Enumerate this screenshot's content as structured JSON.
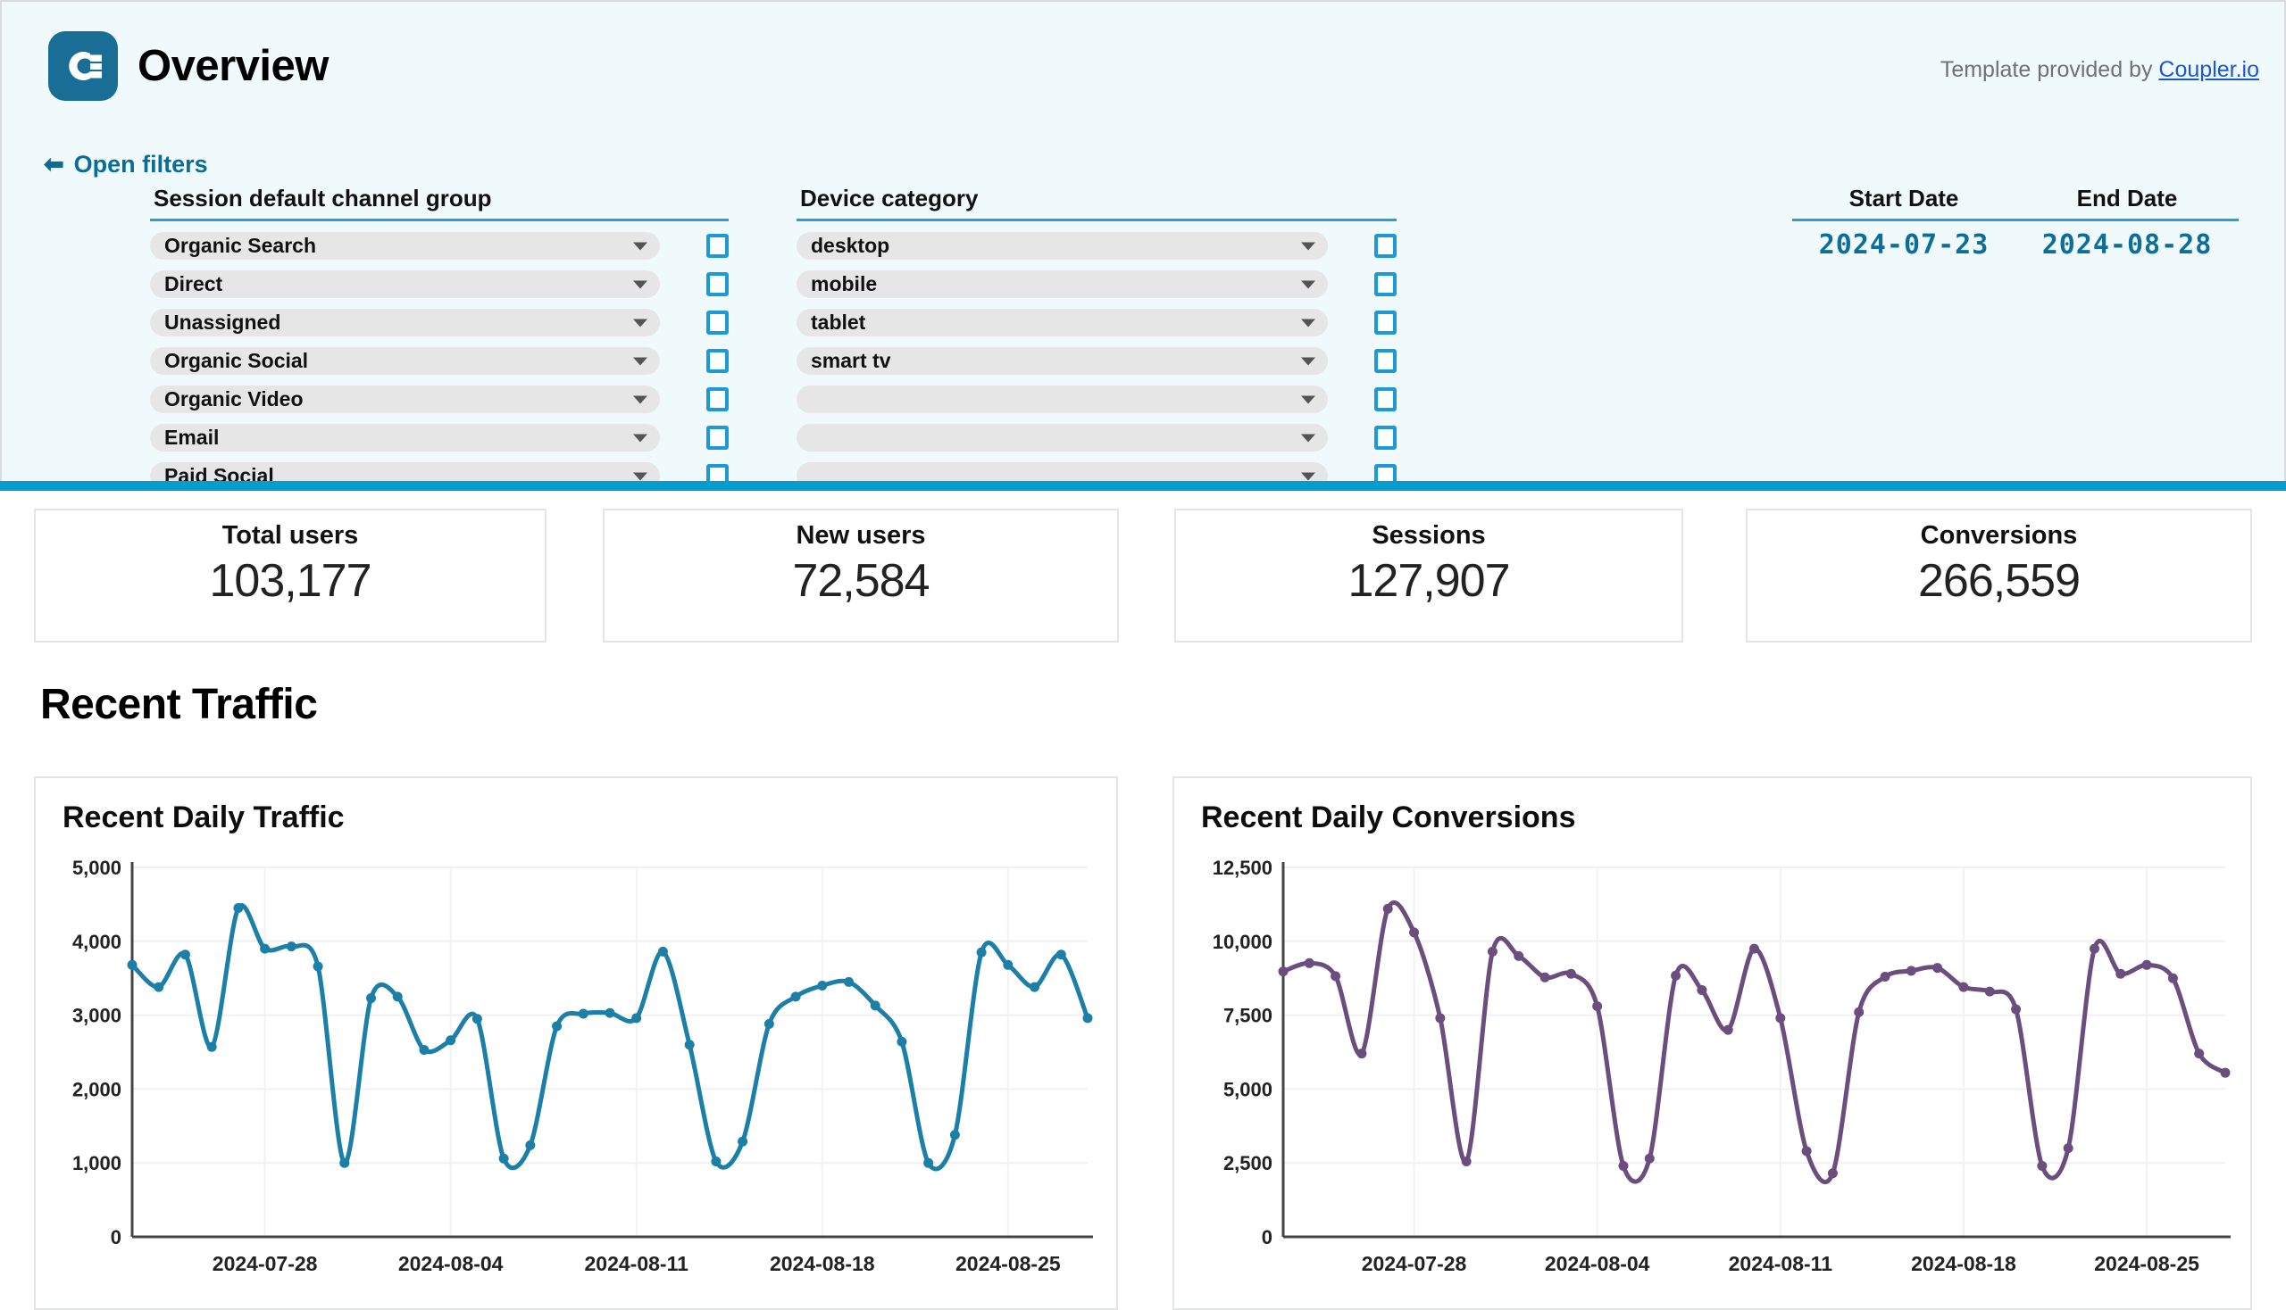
{
  "header": {
    "title": "Overview",
    "logo_icon": "coupler-logo-icon",
    "credit_prefix": "Template provided by ",
    "credit_link": "Coupler.io",
    "open_filters_label": "Open filters",
    "arrow_icon": "arrow-left-icon"
  },
  "filters": {
    "channel_group": {
      "heading": "Session default channel group",
      "rows": [
        {
          "value": "Organic Search",
          "checked": false
        },
        {
          "value": "Direct",
          "checked": false
        },
        {
          "value": "Unassigned",
          "checked": false
        },
        {
          "value": "Organic Social",
          "checked": false
        },
        {
          "value": "Organic Video",
          "checked": false
        },
        {
          "value": "Email",
          "checked": false
        },
        {
          "value": "Paid Social",
          "checked": false
        }
      ]
    },
    "device_category": {
      "heading": "Device category",
      "rows": [
        {
          "value": "desktop",
          "checked": false
        },
        {
          "value": "mobile",
          "checked": false
        },
        {
          "value": "tablet",
          "checked": false
        },
        {
          "value": "smart tv",
          "checked": false
        },
        {
          "value": "",
          "checked": false
        },
        {
          "value": "",
          "checked": false
        },
        {
          "value": "",
          "checked": false
        }
      ]
    },
    "dates": {
      "start_label": "Start Date",
      "end_label": "End Date",
      "start_value": "2024-07-23",
      "end_value": "2024-08-28"
    }
  },
  "kpis": [
    {
      "label": "Total users",
      "value": "103,177"
    },
    {
      "label": "New users",
      "value": "72,584"
    },
    {
      "label": "Sessions",
      "value": "127,907"
    },
    {
      "label": "Conversions",
      "value": "266,559"
    }
  ],
  "section": {
    "title": "Recent Traffic"
  },
  "colors": {
    "accent_blue": "#069cce",
    "panel_bg": "#f0fafd",
    "traffic_line": "#1b7fa8",
    "conversions_line": "#6b4d7e",
    "link_blue": "#1a56d6",
    "date_blue": "#0d6f99"
  },
  "chart_data": [
    {
      "type": "line",
      "title": "Recent Daily Traffic",
      "xlabel": "",
      "ylabel": "",
      "ylim": [
        0,
        5000
      ],
      "yticks": [
        0,
        1000,
        2000,
        3000,
        4000,
        5000
      ],
      "yticklabels": [
        "0",
        "1,000",
        "2,000",
        "3,000",
        "4,000",
        "5,000"
      ],
      "xticklabels": [
        "2024-07-28",
        "2024-08-04",
        "2024-08-11",
        "2024-08-18",
        "2024-08-25"
      ],
      "xtick_indices": [
        5,
        12,
        19,
        26,
        33
      ],
      "grid": true,
      "legend": "none",
      "x": [
        "2024-07-23",
        "2024-07-24",
        "2024-07-25",
        "2024-07-26",
        "2024-07-27",
        "2024-07-28",
        "2024-07-29",
        "2024-07-30",
        "2024-07-31",
        "2024-08-01",
        "2024-08-02",
        "2024-08-03",
        "2024-08-04",
        "2024-08-05",
        "2024-08-06",
        "2024-08-07",
        "2024-08-08",
        "2024-08-09",
        "2024-08-10",
        "2024-08-11",
        "2024-08-12",
        "2024-08-13",
        "2024-08-14",
        "2024-08-15",
        "2024-08-16",
        "2024-08-17",
        "2024-08-18",
        "2024-08-19",
        "2024-08-20",
        "2024-08-21",
        "2024-08-22",
        "2024-08-23",
        "2024-08-24",
        "2024-08-25",
        "2024-08-26",
        "2024-08-27",
        "2024-08-28"
      ],
      "values": [
        3680,
        3380,
        3820,
        2570,
        4450,
        3900,
        3930,
        3660,
        1000,
        3230,
        3250,
        2530,
        2660,
        2950,
        1060,
        1240,
        2850,
        3020,
        3030,
        2960,
        3860,
        2600,
        1020,
        1290,
        2880,
        3250,
        3400,
        3450,
        3130,
        2640,
        1000,
        1380,
        3850,
        3680,
        3380,
        3820,
        2960
      ],
      "series_name": "Daily Traffic",
      "color": "#1b7fa8"
    },
    {
      "type": "line",
      "title": "Recent Daily Conversions",
      "xlabel": "",
      "ylabel": "",
      "ylim": [
        0,
        12500
      ],
      "yticks": [
        0,
        2500,
        5000,
        7500,
        10000,
        12500
      ],
      "yticklabels": [
        "0",
        "2,500",
        "5,000",
        "7,500",
        "10,000",
        "12,500"
      ],
      "xticklabels": [
        "2024-07-28",
        "2024-08-04",
        "2024-08-11",
        "2024-08-18",
        "2024-08-25"
      ],
      "xtick_indices": [
        5,
        12,
        19,
        26,
        33
      ],
      "grid": true,
      "legend": "none",
      "x": [
        "2024-07-23",
        "2024-07-24",
        "2024-07-25",
        "2024-07-26",
        "2024-07-27",
        "2024-07-28",
        "2024-07-29",
        "2024-07-30",
        "2024-07-31",
        "2024-08-01",
        "2024-08-02",
        "2024-08-03",
        "2024-08-04",
        "2024-08-05",
        "2024-08-06",
        "2024-08-07",
        "2024-08-08",
        "2024-08-09",
        "2024-08-10",
        "2024-08-11",
        "2024-08-12",
        "2024-08-13",
        "2024-08-14",
        "2024-08-15",
        "2024-08-16",
        "2024-08-17",
        "2024-08-18",
        "2024-08-19",
        "2024-08-20",
        "2024-08-21",
        "2024-08-22",
        "2024-08-23",
        "2024-08-24",
        "2024-08-25",
        "2024-08-26",
        "2024-08-27",
        "2024-08-28"
      ],
      "values": [
        8980,
        9260,
        8820,
        6200,
        11100,
        10300,
        7400,
        2550,
        9650,
        9500,
        8780,
        8900,
        7800,
        2400,
        2650,
        8840,
        8350,
        7000,
        9750,
        7400,
        2900,
        2150,
        7600,
        8800,
        9000,
        9100,
        8450,
        8300,
        7700,
        2400,
        3000,
        9750,
        8900,
        9200,
        8750,
        6200,
        5550
      ],
      "series_name": "Daily Conversions",
      "color": "#6b4d7e"
    }
  ]
}
